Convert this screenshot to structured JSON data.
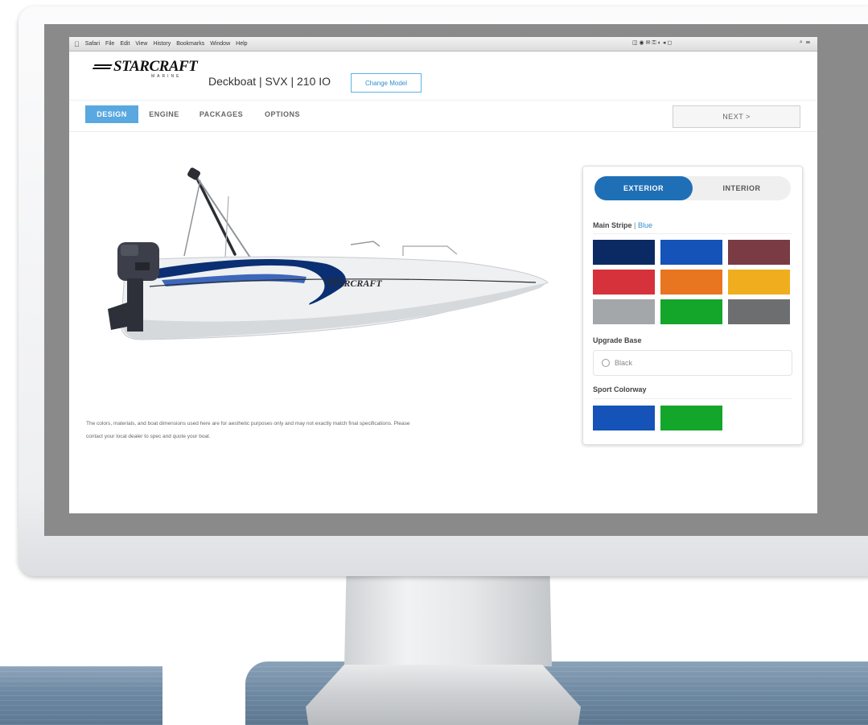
{
  "menubar": {
    "items": [
      "Safari",
      "File",
      "Edit",
      "View",
      "History",
      "Bookmarks",
      "Window",
      "Help"
    ],
    "apple_icon": "apple-icon",
    "right_status": "◫ ◉ ✉ ⚿ ◐ ◂ ◻",
    "search_icon": "⌕ ☰"
  },
  "brand": {
    "logo_text": "STARCRAFT",
    "logo_sub": "MARINE"
  },
  "header": {
    "model_title": "Deckboat | SVX | 210 IO",
    "change_model_label": "Change Model"
  },
  "nav": {
    "tabs": [
      {
        "label": "DESIGN",
        "active": true
      },
      {
        "label": "ENGINE",
        "active": false
      },
      {
        "label": "PACKAGES",
        "active": false
      },
      {
        "label": "OPTIONS",
        "active": false
      }
    ],
    "next_label": "NEXT >"
  },
  "viewer": {
    "hull_text": "STARCRAFT",
    "stripe_color": "#0b2f73",
    "stripe_accent": "#1d4fb0"
  },
  "disclaimer": "The colors, materials, and boat dimensions used here are for aesthetic purposes only and may not exactly match final specifications. Please contact your local dealer to spec and quote your boat.",
  "config": {
    "toggle": {
      "exterior": "EXTERIOR",
      "interior": "INTERIOR",
      "active": "exterior"
    },
    "main_stripe": {
      "label": "Main Stripe",
      "separator": " | ",
      "selected": "Blue",
      "colors": [
        "#0b2a63",
        "#1553b8",
        "#7a3b45",
        "#d6323b",
        "#e87520",
        "#f0ae1e",
        "#a3a7aa",
        "#14a52b",
        "#6d6e70"
      ]
    },
    "upgrade_base": {
      "label": "Upgrade Base",
      "option": "Black"
    },
    "sport_colorway": {
      "label": "Sport Colorway",
      "colors": [
        "#1553b8",
        "#14a52b"
      ]
    }
  }
}
